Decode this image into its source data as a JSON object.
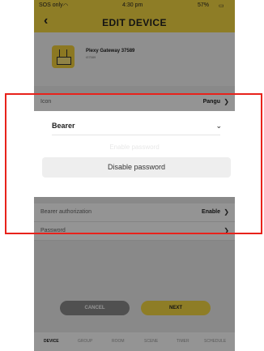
{
  "status_bar": {
    "carrier": "SOS only",
    "time": "4:30 pm",
    "battery": "57%"
  },
  "header": {
    "title": "EDIT DEVICE",
    "back_icon": "chevron-left"
  },
  "device": {
    "name": "Plexy Gateway 37589",
    "id": "t37589"
  },
  "rows": [
    {
      "label": "Icon",
      "value": "Pangu"
    },
    {
      "label": "Bearer authorization",
      "value": "Enable"
    },
    {
      "label": "Password",
      "value": ""
    }
  ],
  "sheet": {
    "dropdown_label": "Bearer",
    "faded_option": "Enable password",
    "disable_button": "Disable password"
  },
  "buttons": {
    "cancel": "CANCEL",
    "next": "NEXT"
  },
  "tabs": [
    "DEVICE",
    "GROUP",
    "ROOM",
    "SCENE",
    "TIMER",
    "SCHEDULE"
  ],
  "colors": {
    "accent": "#f5d743",
    "highlight": "#e8221b"
  }
}
